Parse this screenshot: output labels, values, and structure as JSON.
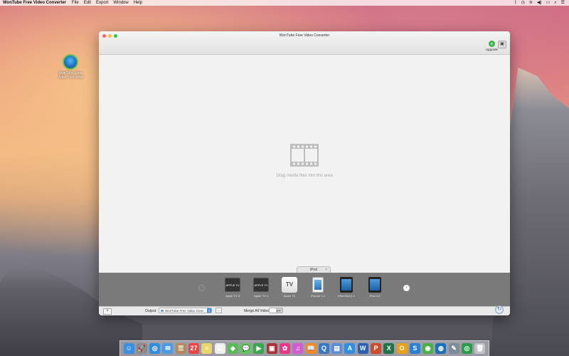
{
  "menubar": {
    "app_name": "WonTube Free Video Converter",
    "menus": [
      "File",
      "Edit",
      "Export",
      "Window",
      "Help"
    ]
  },
  "desktop_icon": {
    "label": "WonTube Free Video Converter"
  },
  "window": {
    "title": "WonTube Free Video Converter",
    "upgrade_label": "Upgrade",
    "upgrade_icon": "+",
    "screen_icon": "▣"
  },
  "drop_area": {
    "hint": "Drag media files into this area"
  },
  "category_tab": {
    "label": "iPod",
    "close": "×"
  },
  "devices": [
    {
      "label": "Apple TV 3",
      "kind": "box",
      "badge": "APPLE TV"
    },
    {
      "label": "Apple TV 2",
      "kind": "box",
      "badge": "APPLE TV"
    },
    {
      "label": "Apple TV",
      "kind": "tv",
      "badge": "TV"
    },
    {
      "label": "iPad Air 1,2",
      "kind": "ipad-white"
    },
    {
      "label": "iPad Mini 2,3",
      "kind": "ipad-dark"
    },
    {
      "label": "iPad 3,4",
      "kind": "ipad-dark"
    }
  ],
  "nav": {
    "prev": "‹",
    "next": "›"
  },
  "page_dots": {
    "count": 6,
    "active": 0
  },
  "bottom": {
    "add_label": "+",
    "output_label": "Output:",
    "output_value": "WonTube Free Video Conv",
    "browse_label": "…",
    "merge_label": "Merge All Videos:",
    "merge_state": "OFF",
    "convert_icon": "↻"
  },
  "dock": {
    "apps": [
      {
        "name": "finder-icon",
        "glyph": "☺",
        "color": "#3b8fe0"
      },
      {
        "name": "launchpad-icon",
        "glyph": "🚀",
        "color": "#8a8a8a"
      },
      {
        "name": "safari-icon",
        "glyph": "◎",
        "color": "#2f8ee0"
      },
      {
        "name": "mail-icon",
        "glyph": "✉",
        "color": "#4a9be2"
      },
      {
        "name": "contacts-icon",
        "glyph": "☰",
        "color": "#b48a5a"
      },
      {
        "name": "calendar-icon",
        "glyph": "27",
        "color": "#e44"
      },
      {
        "name": "notes-icon",
        "glyph": "≡",
        "color": "#e9d66b"
      },
      {
        "name": "reminders-icon",
        "glyph": "☑",
        "color": "#eee"
      },
      {
        "name": "maps-icon",
        "glyph": "◈",
        "color": "#5bb85b"
      },
      {
        "name": "messages-icon",
        "glyph": "💬",
        "color": "#5cc85c"
      },
      {
        "name": "facetime-icon",
        "glyph": "▶",
        "color": "#3ba54f"
      },
      {
        "name": "photobooth-icon",
        "glyph": "▣",
        "color": "#a33"
      },
      {
        "name": "photos-icon",
        "glyph": "✿",
        "color": "#e38"
      },
      {
        "name": "itunes-icon",
        "glyph": "♫",
        "color": "#d45bd4"
      },
      {
        "name": "ibooks-icon",
        "glyph": "📖",
        "color": "#f08a24"
      },
      {
        "name": "quicktime-icon",
        "glyph": "Q",
        "color": "#3a78c2"
      },
      {
        "name": "preview-icon",
        "glyph": "▤",
        "color": "#5a8ed6"
      },
      {
        "name": "appstore-icon",
        "glyph": "A",
        "color": "#2f8ee0"
      },
      {
        "name": "word-icon",
        "glyph": "W",
        "color": "#2b5fb6"
      },
      {
        "name": "powerpoint-icon",
        "glyph": "P",
        "color": "#d04a2a"
      },
      {
        "name": "excel-icon",
        "glyph": "X",
        "color": "#217346"
      },
      {
        "name": "outlook-icon",
        "glyph": "O",
        "color": "#e8a018"
      },
      {
        "name": "lync-icon",
        "glyph": "S",
        "color": "#2d7fd3"
      },
      {
        "name": "network-icon",
        "glyph": "◉",
        "color": "#4bb04b"
      },
      {
        "name": "wontube-icon",
        "glyph": "◍",
        "color": "#1f6fb6"
      },
      {
        "name": "utility-icon",
        "glyph": "✎",
        "color": "#7d8c9a"
      },
      {
        "name": "wontube-dock-icon",
        "glyph": "◎",
        "color": "#2a9d4a"
      },
      {
        "name": "trash-icon",
        "glyph": "🗑",
        "color": "#bfc3c8"
      }
    ]
  }
}
